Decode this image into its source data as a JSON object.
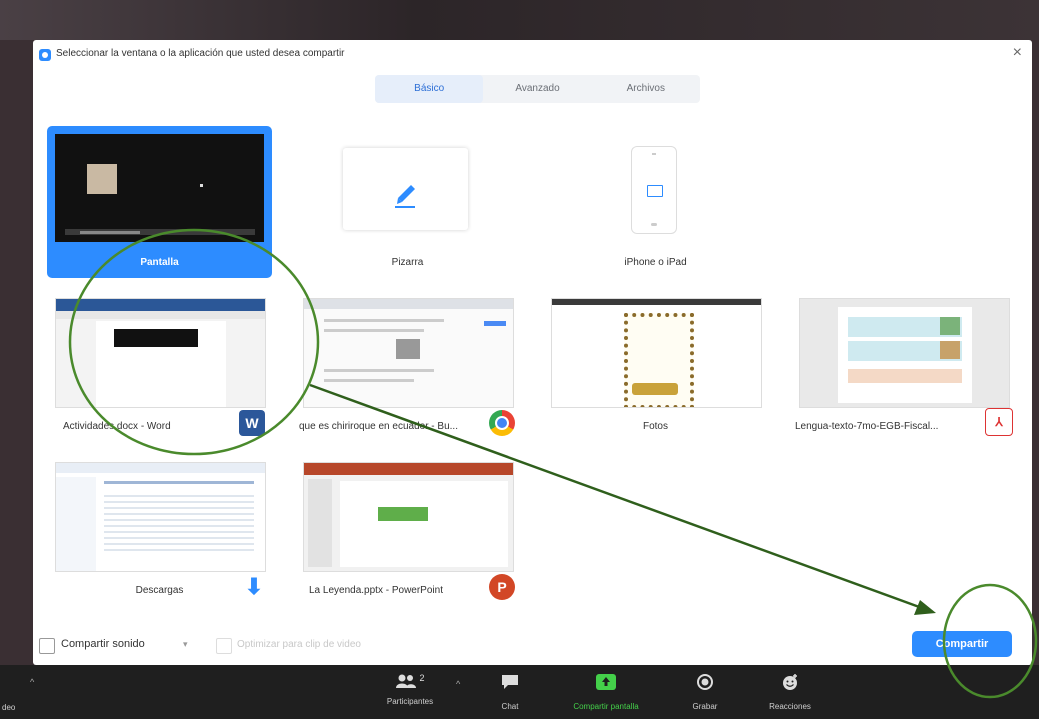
{
  "dialog": {
    "title": "Seleccionar la ventana o la aplicación que usted desea compartir",
    "close_glyph": "×"
  },
  "tabs": [
    {
      "label": "Básico"
    },
    {
      "label": "Avanzado"
    },
    {
      "label": "Archivos"
    }
  ],
  "tiles": [
    {
      "label": "Pantalla",
      "icon": "screen-icon"
    },
    {
      "label": "Pizarra",
      "icon": "pencil-icon"
    },
    {
      "label": "iPhone o iPad",
      "icon": "ipad-icon"
    },
    {
      "label": "Actividades.docx - Word",
      "icon": "word-icon"
    },
    {
      "label": "que es chiriroque en ecuador - Bu...",
      "icon": "chrome-icon"
    },
    {
      "label": "Fotos",
      "icon": "photos-icon"
    },
    {
      "label": "Lengua-texto-7mo-EGB-Fiscal...",
      "icon": "pdf-icon"
    },
    {
      "label": "Descargas",
      "icon": "download-arrow-icon"
    },
    {
      "label": "La Leyenda.pptx - PowerPoint",
      "icon": "powerpoint-icon"
    }
  ],
  "footer": {
    "share_sound_label": "Compartir sonido",
    "optimize_label": "Optimizar para clip de video",
    "share_button": "Compartir"
  },
  "toolbar": {
    "participants_label": "Participantes",
    "participants_count": "2",
    "chat_label": "Chat",
    "share_screen_label": "Compartir pantalla",
    "record_label": "Grabar",
    "reactions_label": "Reacciones",
    "left_label": "deo"
  },
  "colors": {
    "accent": "#2d8cff",
    "toolbar_bg": "#1f1f1f",
    "share_green": "#44d04a",
    "annotation_green": "#4a8a2c"
  }
}
